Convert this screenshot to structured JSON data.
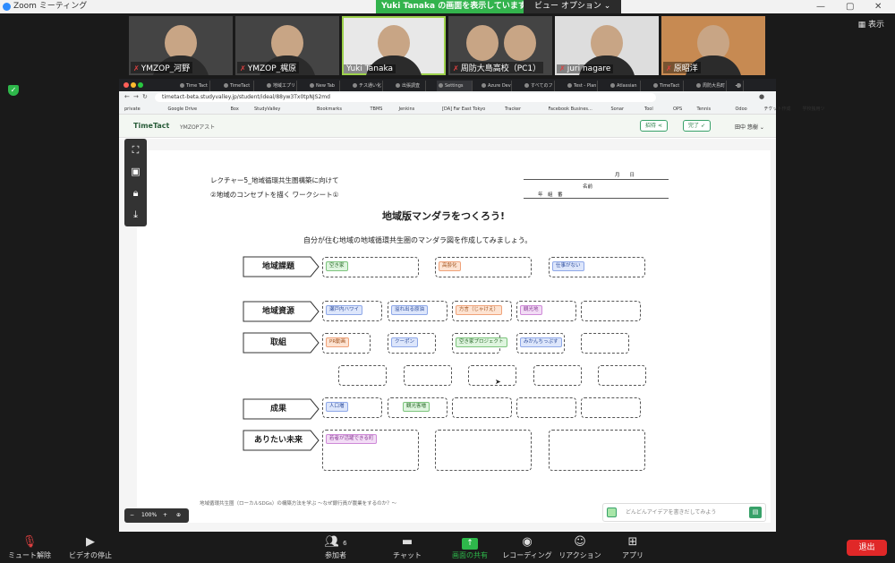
{
  "zoom": {
    "title": "Zoom ミーティング",
    "share_banner": "Yuki Tanaka の画面を表示しています",
    "view_options": "ビュー オプション ⌄",
    "view": "表示",
    "min": "—",
    "max": "▢",
    "close": "✕"
  },
  "participants": [
    {
      "name": "YMZOP_河野",
      "muted": true
    },
    {
      "name": "YMZOP_梶原",
      "muted": true
    },
    {
      "name": "Yuki Tanaka",
      "muted": false
    },
    {
      "name": "周防大島高校（PC1）",
      "muted": true
    },
    {
      "name": "juri nagare",
      "muted": true
    },
    {
      "name": "原昭洋",
      "muted": true
    }
  ],
  "browser": {
    "tabs": [
      "Time Tact",
      "TimeTact",
      "地域エプリ",
      "New Tab",
      "チス通い化",
      "出張調査",
      "Settings",
      "Azure Dev",
      "すべてのフ",
      "Test - Plan",
      "Atlassian",
      "TimeTact",
      "周防大島町"
    ],
    "url": "timetact-beta.studyvalley.jp/student/ideal/88yw3Tx0tpNJS2md",
    "bookmarks": [
      "private",
      "Google Drive",
      "Box",
      "StudyValley",
      "Bookmarks",
      "TBMS",
      "Jenkins",
      "[DA] Far East Tokyo",
      "Tracker",
      "Facebook Busines...",
      "Sonar",
      "Tool",
      "OPS",
      "Tennis",
      "Odoo",
      "チケット作成",
      "学校独用ツ"
    ]
  },
  "app": {
    "logo": "TimeTact",
    "room": "YMZOPアスト",
    "invite": "招待",
    "done": "完了",
    "user": "田中 悠樹 ⌄",
    "zoom": "100%",
    "idea_placeholder": "どんどんアイデアを書きだしてみよう"
  },
  "sheet": {
    "lecture": "レクチャー5_地域循環共生圏構築に向けて",
    "sub": "②地域のコンセプトを描く ワークシート①",
    "date": "月　　日",
    "name": "名前",
    "grade": "年　組　番",
    "title": "地域版マンダラをつくろう!",
    "instruction": "自分が住む地域の地域循環共生圏のマンダラ図を作成してみましょう。",
    "categories": [
      "地域課題",
      "地域資源",
      "取組",
      "成果",
      "ありたい未来"
    ],
    "chips": {
      "issue1": "空き家",
      "issue2": "高齢化",
      "issue3": "仕事がない",
      "res1": "瀬戸内ハワイ",
      "res2": "溢れ出る原油",
      "res3": "方言（じゃけえ）",
      "res4": "観光地",
      "act1": "PR動画",
      "act2": "クーポン",
      "act3": "空き家プロジェクト",
      "act4": "みかんちっぷす",
      "out1": "人口増",
      "out2": "観光客増",
      "fut1": "若者が活躍できる町"
    },
    "footnote": "地域循環共生圏（ローカルSDGs）の構築方法を学ぶ ～なぜ銀行員が農業をするのか？～"
  },
  "toolbar": {
    "mute": "ミュート解除",
    "video": "ビデオの停止",
    "participants": "参加者",
    "participants_count": "6",
    "chat": "チャット",
    "share": "画面の共有",
    "record": "レコーディング",
    "reactions": "リアクション",
    "apps": "アプリ",
    "exit": "退出"
  }
}
